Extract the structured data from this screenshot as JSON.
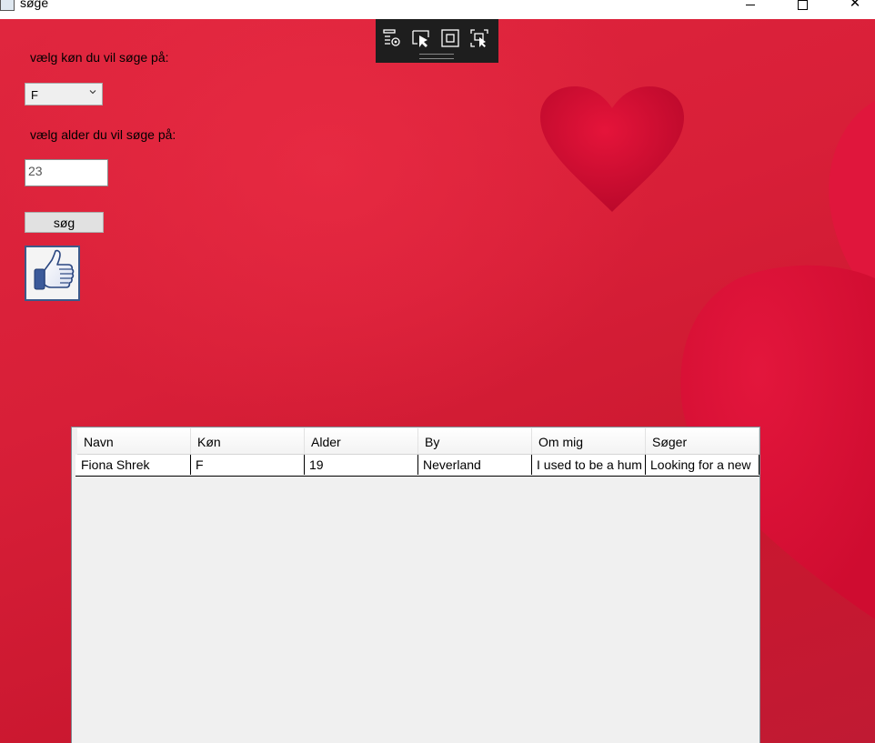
{
  "window": {
    "title": "søge",
    "close_glyph": "✕"
  },
  "form": {
    "gender_label": "vælg køn du vil søge på:",
    "gender_value": "F",
    "age_label": "vælg alder du vil søge på:",
    "age_value": "23",
    "search_button": "søg",
    "like_icon": "thumbs-up-icon"
  },
  "debug_toolbar": {
    "icons": [
      "live-visual-tree-icon",
      "select-element-icon",
      "display-layout-adorners-icon",
      "track-focus-icon"
    ]
  },
  "grid": {
    "columns": [
      "Navn",
      "Køn",
      "Alder",
      "By",
      "Om mig",
      "Søger"
    ],
    "rows": [
      [
        "Fiona Shrek",
        "F",
        "19",
        "Neverland",
        "I used to be a hum",
        "Looking for a new"
      ]
    ]
  },
  "colors": {
    "background_red": "#d81f38",
    "toolbar_dark": "#1e1e1e",
    "like_border": "#3c5a8a"
  }
}
